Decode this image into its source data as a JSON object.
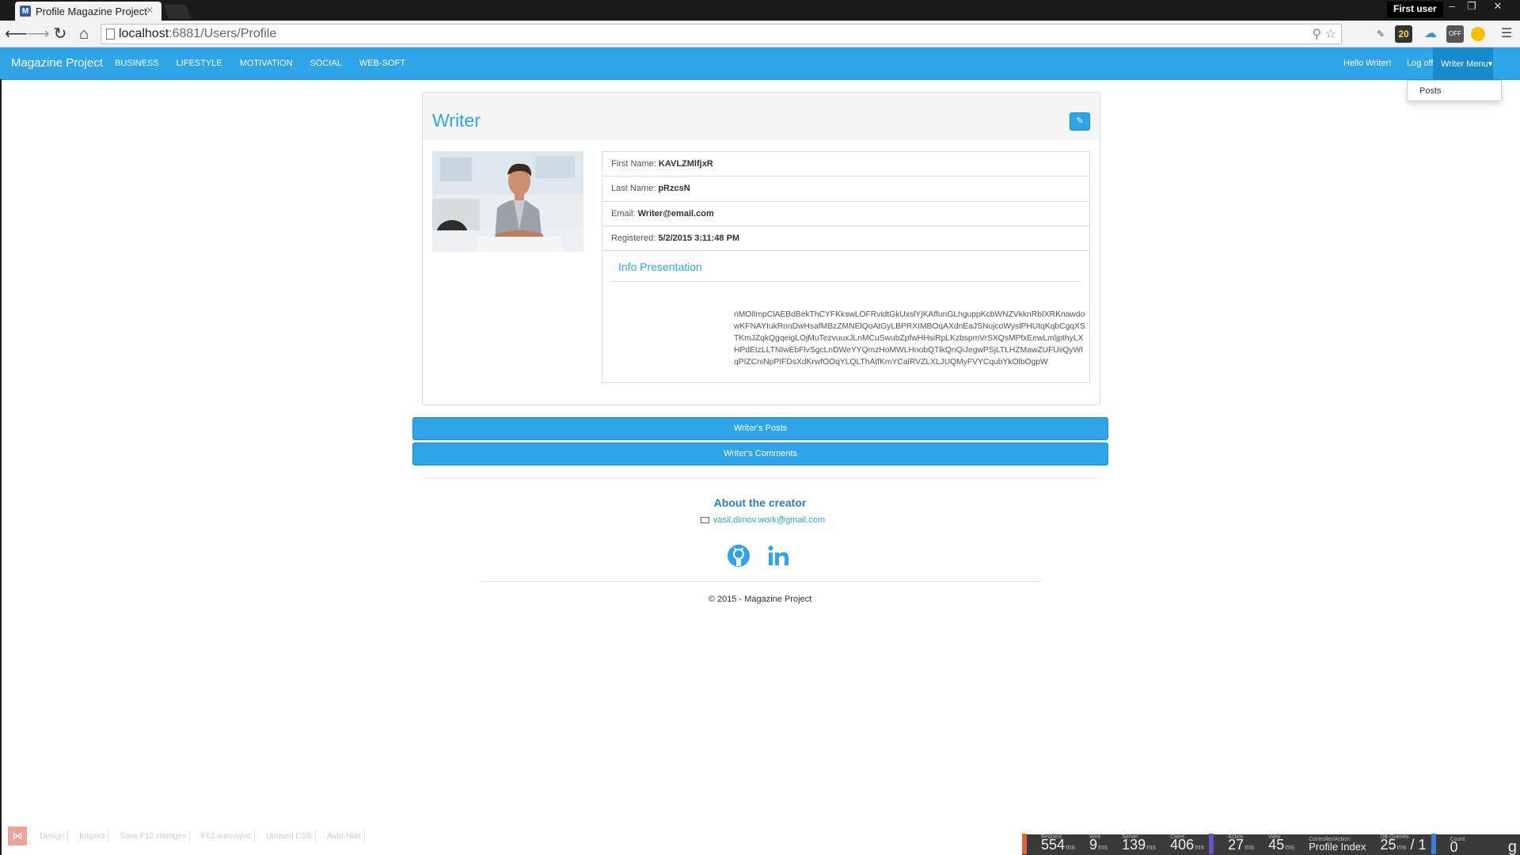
{
  "browser": {
    "tab_title": "Profile Magazine Project",
    "favicon_letter": "M",
    "user_label": "First user",
    "url_host": "localhost",
    "url_path": ":6881/Users/Profile",
    "ext_badge_count": "20",
    "ext_off_label": "OFF"
  },
  "nav": {
    "brand": "Magazine Project",
    "links": [
      "BUSINESS",
      "LIFESTYLE",
      "MOTIVATION",
      "SOCIAL",
      "WEB-SOFT"
    ],
    "hello": "Hello Writer!",
    "logoff": "Log off",
    "writer_menu": "Writer Menu",
    "dropdown_item": "Posts"
  },
  "profile": {
    "title": "Writer",
    "first_name_label": "First Name:",
    "first_name": "KAVLZMlfjxR",
    "last_name_label": "Last Name:",
    "last_name": "pRzcsN",
    "email_label": "Email:",
    "email": "Writer@email.com",
    "registered_label": "Registered:",
    "registered": "5/2/2015 3:11:48 PM",
    "info_title": "Info Presentation",
    "info_text": "nMOIlmpClAEBdBekThCYFKkswLOFRvidtGkUxslYjKAffunGLhguppKcbWNZVkknRbIXRKnawdowKFNAYIukRonDwHsafMBzZMNElQoAtGyLBPRXIMBOqAXdnEaJSNujcoWyslPHUtqKqbCgqXSTKmJZqkQgqeigLOjMuTezvuuxJLnMCuSwubZpfwHHsiRpLKzbspmVrSXQsMPfxEewLmljpthyLXHPdEtzLLTNIwEbFlvSgcLnDWeYYQmzHoMWLHnobQTlkQnQiJegwPSjLTLHZMawZUFUiiQyWIqPIZCniNpPIFDsXdKrwfOOqYLQLThAtfKmYCalRVZLXLJUQMyFVYCqubYkOlbOgpW"
  },
  "buttons": {
    "posts": "Writer's Posts",
    "comments": "Writer's Comments"
  },
  "footer": {
    "about": "About the creator",
    "email": "vasil.dimov.work@gmail.com",
    "copyright": "© 2015 - Magazine Project"
  },
  "vs_bar": {
    "items": [
      "Design",
      "Inspect",
      "Save F12 changes",
      "F12 auto-sync",
      "Unused CSS",
      "Auto-hide"
    ]
  },
  "glimpse": {
    "request": "554",
    "request_label": "Request",
    "wire": "9",
    "wire_label": "Wire",
    "server": "139",
    "server_label": "Server",
    "client": "406",
    "client_label": "Client",
    "action": "27",
    "action_label": "Action",
    "view": "45",
    "view_label": "View",
    "controller": "Profile Index",
    "controller_label": "Controller/Action",
    "db_queries": "25",
    "db_queries_label": "DB Queries",
    "db_count": "1",
    "count": "0",
    "count_label": "Count",
    "unit": "ms"
  },
  "colors": {
    "accent": "#2fa4e7",
    "accent_dark": "#178acc"
  }
}
